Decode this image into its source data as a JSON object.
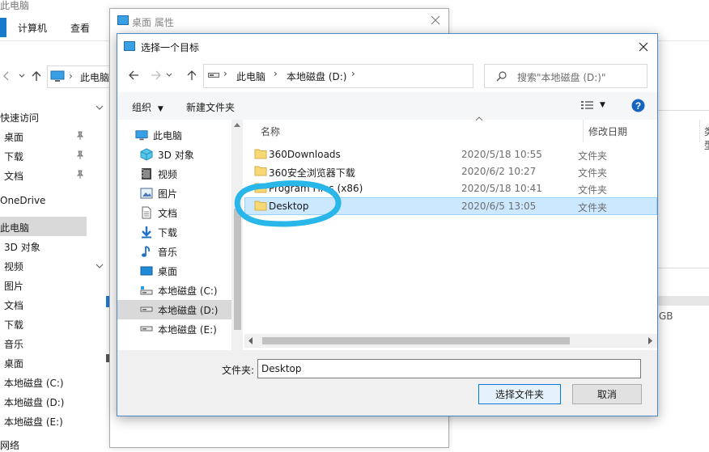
{
  "background_explorer": {
    "title": "此电脑",
    "tabs": [
      "计算机",
      "查看"
    ],
    "address_path": "此电脑",
    "sidebar_items": [
      "快速访问",
      "桌面",
      "下载",
      "文档",
      "OneDrive",
      "此电脑",
      "3D 对象",
      "视频",
      "图片",
      "文档",
      "下载",
      "音乐",
      "桌面",
      "本地磁盘 (C:)",
      "本地磁盘 (D:)",
      "本地磁盘 (E:)",
      "网络"
    ],
    "size_fragment": "GB"
  },
  "properties_window": {
    "title": "桌面 属性"
  },
  "dialog": {
    "title": "选择一个目标",
    "breadcrumb": [
      "此电脑",
      "本地磁盘 (D:)"
    ],
    "search_placeholder": "搜索\"本地磁盘 (D:)\"",
    "toolbar": {
      "organize": "组织",
      "new_folder": "新建文件夹"
    },
    "tree_items": [
      {
        "label": "此电脑",
        "icon": "computer-icon"
      },
      {
        "label": "3D 对象",
        "icon": "3d-objects-icon"
      },
      {
        "label": "视频",
        "icon": "video-icon"
      },
      {
        "label": "图片",
        "icon": "pictures-icon"
      },
      {
        "label": "文档",
        "icon": "documents-icon"
      },
      {
        "label": "下载",
        "icon": "downloads-icon"
      },
      {
        "label": "音乐",
        "icon": "music-icon"
      },
      {
        "label": "桌面",
        "icon": "desktop-icon"
      },
      {
        "label": "本地磁盘 (C:)",
        "icon": "drive-icon"
      },
      {
        "label": "本地磁盘 (D:)",
        "icon": "drive-icon"
      },
      {
        "label": "本地磁盘 (E:)",
        "icon": "drive-icon"
      }
    ],
    "columns": [
      "名称",
      "修改日期",
      "类型"
    ],
    "files": [
      {
        "name": "360Downloads",
        "date": "2020/5/18 10:55",
        "type": "文件夹"
      },
      {
        "name": "360安全浏览器下载",
        "date": "2020/6/2 10:27",
        "type": "文件夹"
      },
      {
        "name": "Program Files (x86)",
        "date": "2020/5/18 10:41",
        "type": "文件夹"
      },
      {
        "name": "Desktop",
        "date": "2020/6/5 13:05",
        "type": "文件夹"
      }
    ],
    "folder_label": "文件夹:",
    "folder_value": "Desktop",
    "select_button": "选择文件夹",
    "cancel_button": "取消"
  },
  "colors": {
    "accent": "#0078d7",
    "selection": "#cce8ff",
    "annotation": "#29b6e8",
    "folder": "#f8d775"
  }
}
